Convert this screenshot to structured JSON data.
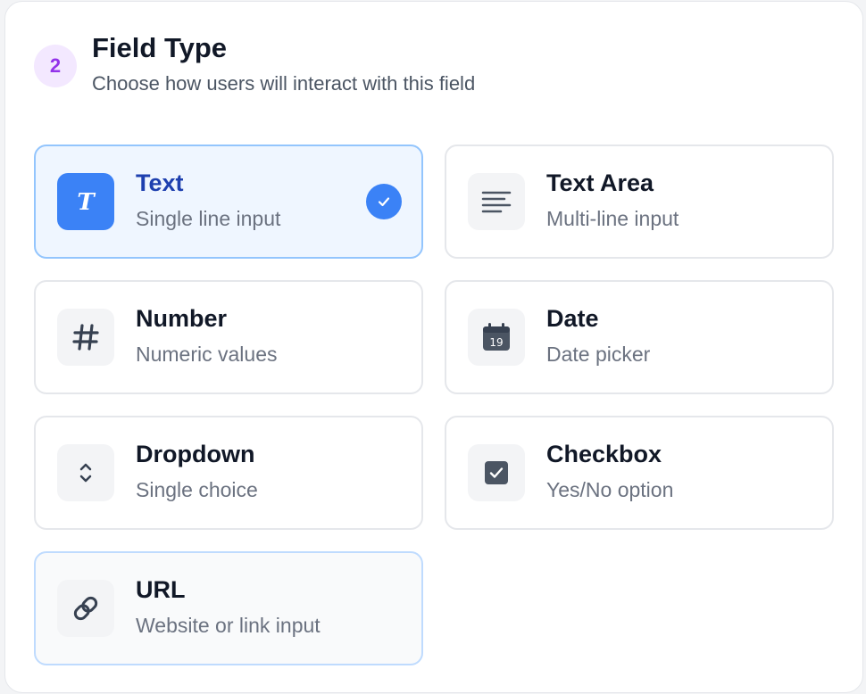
{
  "header": {
    "step_number": "2",
    "title": "Field Type",
    "subtitle": "Choose how users will interact with this field"
  },
  "options": [
    {
      "label": "Text",
      "description": "Single line input",
      "icon": "text-italic-t-icon",
      "selected": true
    },
    {
      "label": "Text Area",
      "description": "Multi-line input",
      "icon": "align-left-icon",
      "selected": false
    },
    {
      "label": "Number",
      "description": "Numeric values",
      "icon": "hash-icon",
      "selected": false
    },
    {
      "label": "Date",
      "description": "Date picker",
      "icon": "calendar-icon",
      "icon_text": "19",
      "selected": false
    },
    {
      "label": "Dropdown",
      "description": "Single choice",
      "icon": "chevron-up-down-icon",
      "selected": false
    },
    {
      "label": "Checkbox",
      "description": "Yes/No option",
      "icon": "checkbox-icon",
      "selected": false
    },
    {
      "label": "URL",
      "description": "Website or link input",
      "icon": "link-icon",
      "selected": false,
      "hovered": true
    }
  ],
  "colors": {
    "accent": "#3b82f6",
    "selected_bg": "#eff6ff",
    "badge_bg": "#f3e8ff",
    "badge_text": "#9333ea"
  }
}
